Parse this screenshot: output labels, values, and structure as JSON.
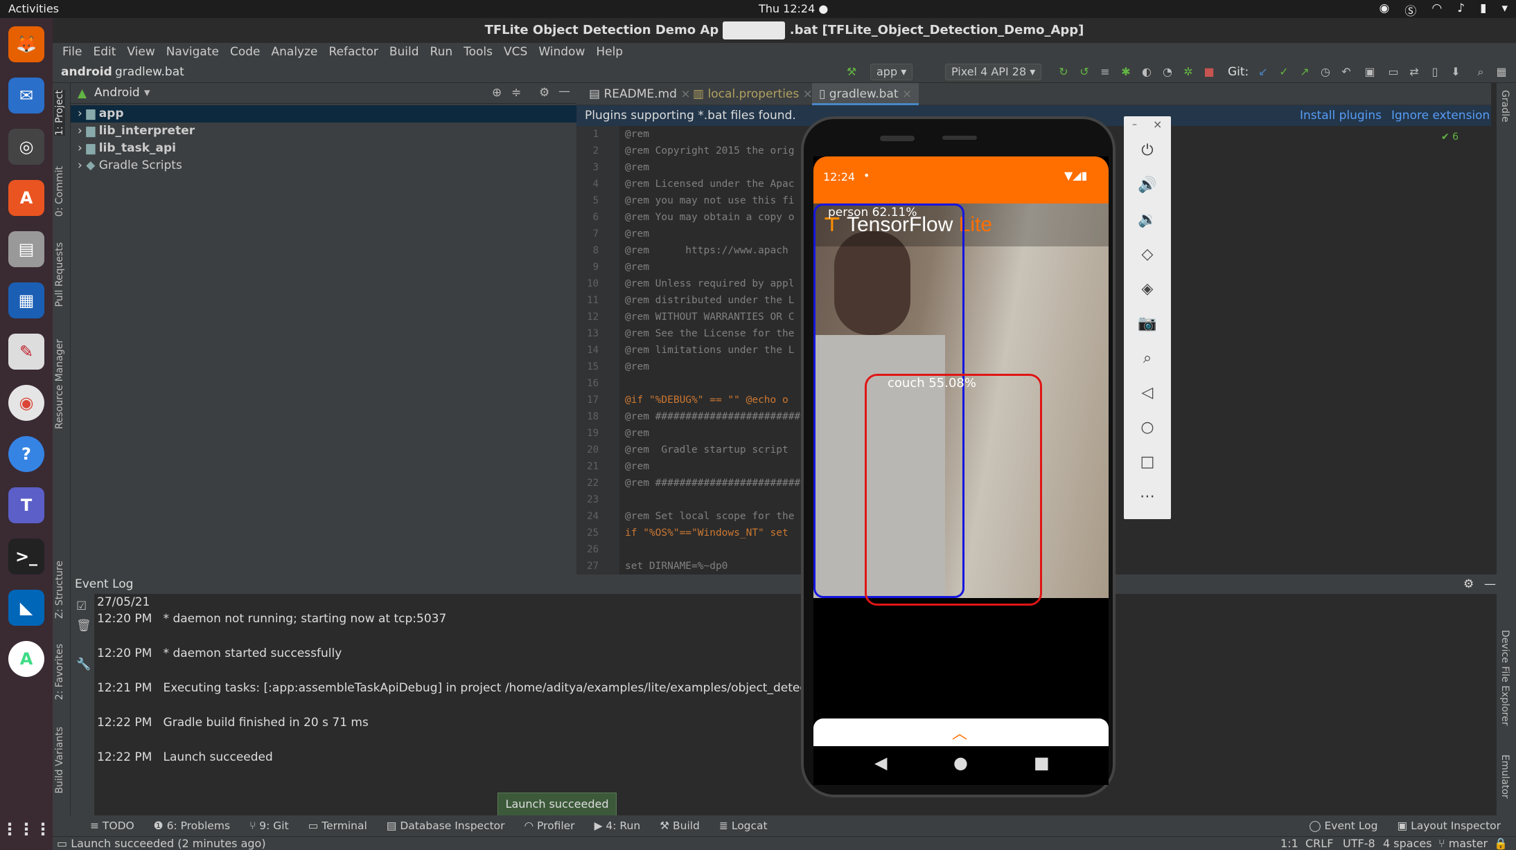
{
  "system": {
    "activities": "Activities",
    "clock": "Thu 12:24 ●"
  },
  "window": {
    "title_left": "TFLite Object Detection Demo Ap",
    "title_right": ".bat [TFLite_Object_Detection_Demo_App]"
  },
  "menu": [
    "File",
    "Edit",
    "View",
    "Navigate",
    "Code",
    "Analyze",
    "Refactor",
    "Build",
    "Run",
    "Tools",
    "VCS",
    "Window",
    "Help"
  ],
  "nav": {
    "root": "android",
    "file": "gradlew.bat",
    "run_config": "app",
    "device": "Pixel 4 API 28",
    "git_label": "Git:"
  },
  "project": {
    "view": "Android",
    "items": [
      "app",
      "lib_interpreter",
      "lib_task_api",
      "Gradle Scripts"
    ]
  },
  "tabs": [
    "README.md",
    "local.properties",
    "gradlew.bat"
  ],
  "banner": {
    "text": "Plugins supporting *.bat files found.",
    "install": "Install plugins",
    "ignore": "Ignore extension",
    "count": "✔ 6"
  },
  "code": [
    "@rem",
    "@rem Copyright 2015 the orig",
    "@rem",
    "@rem Licensed under the Apac",
    "@rem you may not use this fi",
    "@rem You may obtain a copy o",
    "@rem",
    "@rem      https://www.apach",
    "@rem",
    "@rem Unless required by appl",
    "@rem distributed under the L",
    "@rem WITHOUT WARRANTIES OR C",
    "@rem See the License for the",
    "@rem limitations under the L",
    "@rem",
    "",
    "@if \"%DEBUG%\" == \"\" @echo o",
    "@rem ########################",
    "@rem",
    "@rem  Gradle startup script",
    "@rem",
    "@rem ########################",
    "",
    "@rem Set local scope for the",
    "if \"%OS%\"==\"Windows_NT\" set",
    "",
    "set DIRNAME=%~dp0"
  ],
  "line_numbers": [
    "1",
    "2",
    "3",
    "4",
    "5",
    "6",
    "7",
    "8",
    "9",
    "10",
    "11",
    "12",
    "13",
    "14",
    "15",
    "16",
    "17",
    "18",
    "19",
    "20",
    "21",
    "22",
    "23",
    "24",
    "25",
    "26",
    "27"
  ],
  "event_log": {
    "title": "Event Log",
    "date": "27/05/21",
    "entries": [
      {
        "time": "12:20 PM",
        "msg": "* daemon not running; starting now at tcp:5037"
      },
      {
        "time": "12:20 PM",
        "msg": "* daemon started successfully"
      },
      {
        "time": "12:21 PM",
        "msg": "Executing tasks: [:app:assembleTaskApiDebug] in project /home/aditya/examples/lite/examples/object_detection/andr"
      },
      {
        "time": "12:22 PM",
        "msg": "Gradle build finished in 20 s 71 ms"
      },
      {
        "time": "12:22 PM",
        "msg": "Launch succeeded"
      }
    ]
  },
  "left_tools": [
    "1: Project",
    "0: Commit",
    "Pull Requests",
    "Resource Manager",
    "Z: Structure",
    "2: Favorites",
    "Build Variants"
  ],
  "right_tools": [
    "Gradle",
    "Device File Explorer",
    "Emulator"
  ],
  "bottom_tools": [
    "TODO",
    "6: Problems",
    "9: Git",
    "Terminal",
    "Database Inspector",
    "Profiler",
    "4: Run",
    "Build",
    "Logcat"
  ],
  "bottom_right": [
    "Event Log",
    "Layout Inspector"
  ],
  "toast": "Launch succeeded",
  "status": {
    "left": "Launch succeeded (2 minutes ago)",
    "pos": "1:1",
    "eol": "CRLF",
    "enc": "UTF-8",
    "indent": "4 spaces",
    "branch": "master"
  },
  "phone": {
    "time": "12:24",
    "app_name_a": "TensorFlow",
    "app_name_b": "Lite",
    "det1": "person 62.11%",
    "det2": "couch 55.08%"
  },
  "colors": {
    "accent": "#ff6f00",
    "box_person": "#1515e0",
    "box_couch": "#e01515"
  }
}
